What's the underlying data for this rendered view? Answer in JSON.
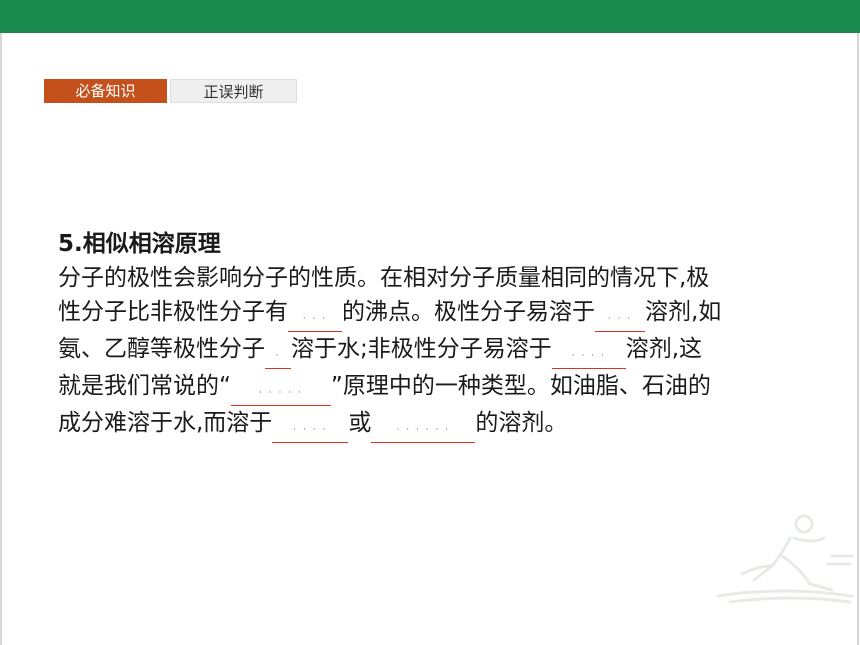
{
  "tabs": {
    "active_label": "必备知识",
    "inactive_label": "正误判断"
  },
  "section": {
    "heading": "5.相似相溶原理",
    "lines": [
      [
        "分子的极性会影响分子的性质。在相对分子质量相同的情况下,极"
      ],
      [
        "性分子比非极性分子有",
        {
          "blank": "· · ·"
        },
        "的沸点。极性分子易溶于",
        {
          "blank": "· · ·"
        },
        "溶剂,如"
      ],
      [
        "氨、乙醇等极性分子",
        {
          "blank": "·"
        },
        "溶于水;非极性分子易溶于",
        {
          "blank": "· · · ·"
        },
        "溶剂,这"
      ],
      [
        "就是我们常说的“",
        {
          "blank": "· · · · ·"
        },
        "”原理中的一种类型。如油脂、石油的"
      ],
      [
        "成分难溶于水,而溶于",
        {
          "blank": "· · · ·"
        },
        "或",
        {
          "blank": "· · · · · ·"
        },
        "的溶剂。"
      ]
    ]
  },
  "colors": {
    "top_bar": "#1a8a4e",
    "tab_active": "#c4511b",
    "blank_underline": "#e0301e"
  },
  "icons": {
    "watermark": "runner-watermark-icon"
  }
}
